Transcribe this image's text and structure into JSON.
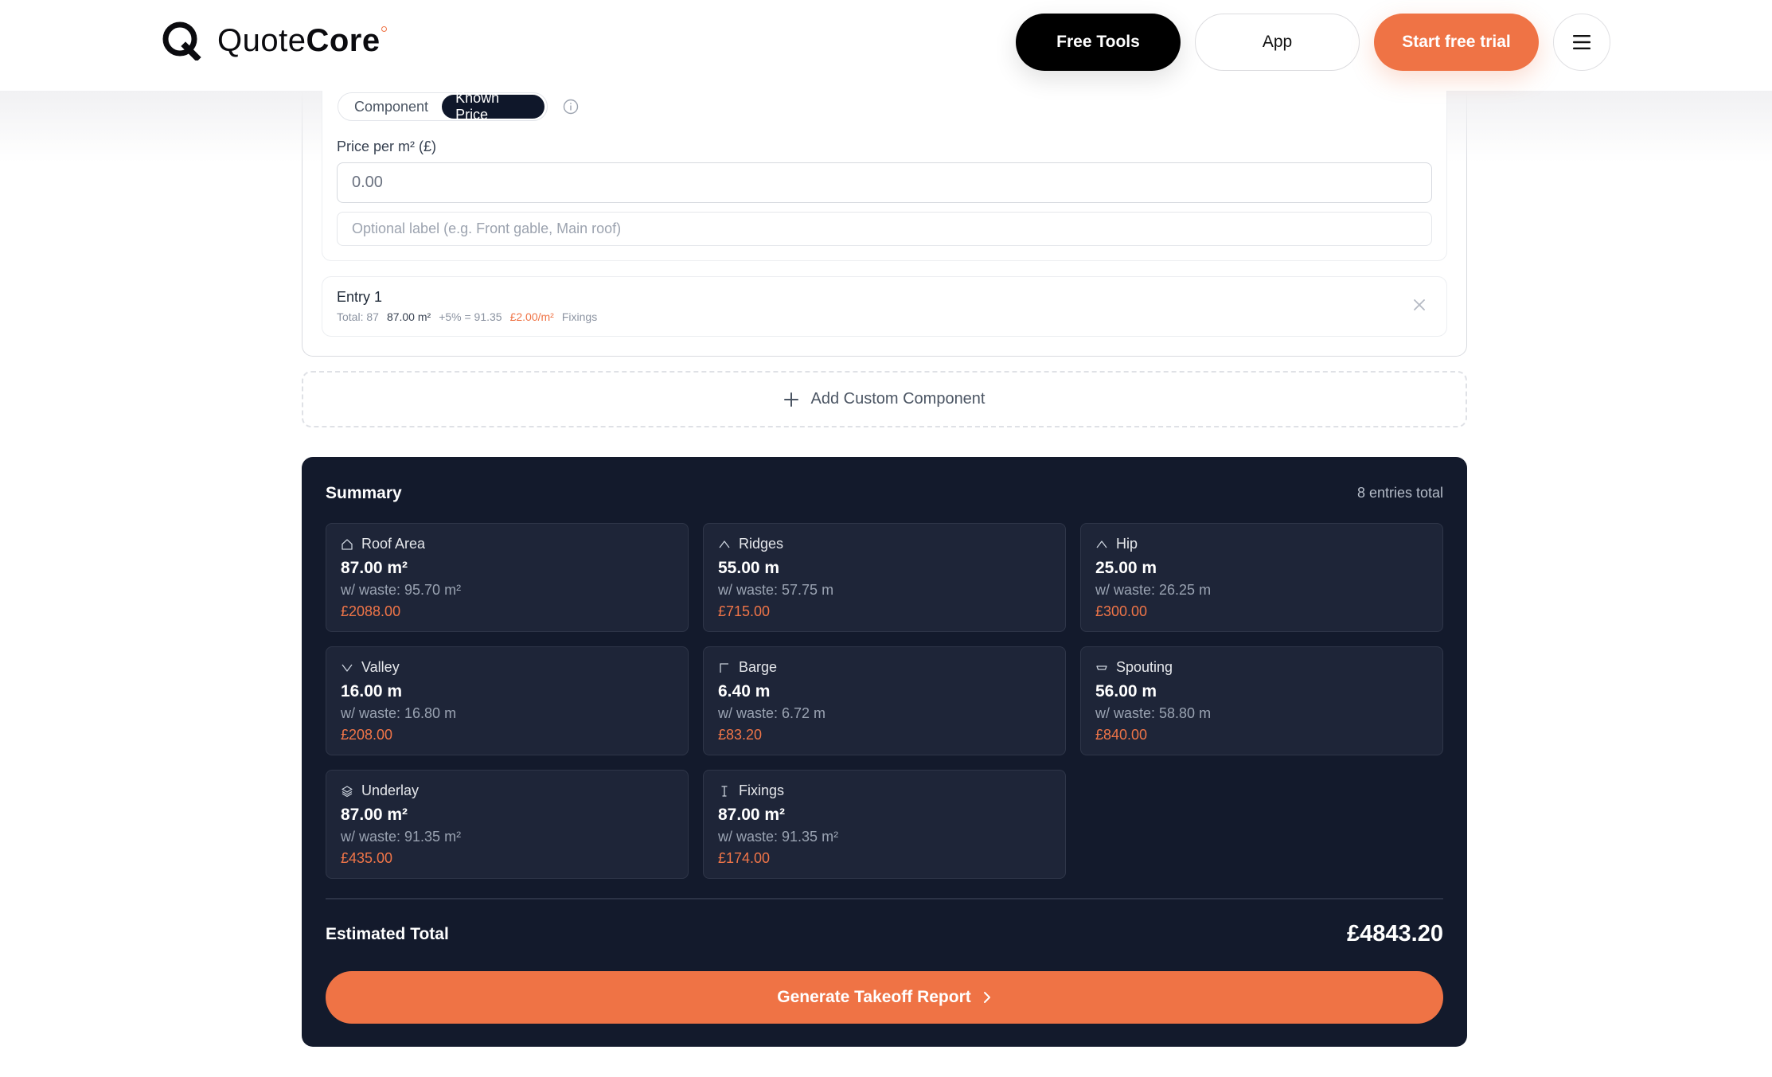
{
  "header": {
    "logo_light": "Quote",
    "logo_bold": "Core",
    "free_tools": "Free Tools",
    "app": "App",
    "start_trial": "Start free trial"
  },
  "component_form": {
    "mode_options": [
      "Component",
      "Known Price"
    ],
    "selected_mode": "Known Price",
    "price_label": "Price per m² (£)",
    "price_placeholder": "0.00",
    "label_placeholder": "Optional label (e.g. Front gable, Main roof)"
  },
  "entry": {
    "title": "Entry 1",
    "total": "Total: 87",
    "area": "87.00 m²",
    "waste": "+5% = 91.35",
    "rate": "£2.00/m²",
    "type": "Fixings"
  },
  "add_custom_label": "Add Custom Component",
  "summary": {
    "title": "Summary",
    "count": "8 entries total",
    "items": [
      {
        "icon": "house-icon",
        "name": "Roof Area",
        "value": "87.00 m²",
        "waste": "w/ waste: 95.70 m²",
        "price": "£2088.00"
      },
      {
        "icon": "ridge-icon",
        "name": "Ridges",
        "value": "55.00 m",
        "waste": "w/ waste: 57.75 m",
        "price": "£715.00"
      },
      {
        "icon": "hip-icon",
        "name": "Hip",
        "value": "25.00 m",
        "waste": "w/ waste: 26.25 m",
        "price": "£300.00"
      },
      {
        "icon": "valley-icon",
        "name": "Valley",
        "value": "16.00 m",
        "waste": "w/ waste: 16.80 m",
        "price": "£208.00"
      },
      {
        "icon": "barge-icon",
        "name": "Barge",
        "value": "6.40 m",
        "waste": "w/ waste: 6.72 m",
        "price": "£83.20"
      },
      {
        "icon": "gutter-icon",
        "name": "Spouting",
        "value": "56.00 m",
        "waste": "w/ waste: 58.80 m",
        "price": "£840.00"
      },
      {
        "icon": "layers-icon",
        "name": "Underlay",
        "value": "87.00 m²",
        "waste": "w/ waste: 91.35 m²",
        "price": "£435.00"
      },
      {
        "icon": "fixing-icon",
        "name": "Fixings",
        "value": "87.00 m²",
        "waste": "w/ waste: 91.35 m²",
        "price": "£174.00"
      }
    ],
    "total_label": "Estimated Total",
    "total_value": "£4843.20",
    "generate_label": "Generate Takeoff Report"
  },
  "colors": {
    "accent": "#ef7345",
    "navy": "#131a2c",
    "tile": "#1e2538"
  }
}
